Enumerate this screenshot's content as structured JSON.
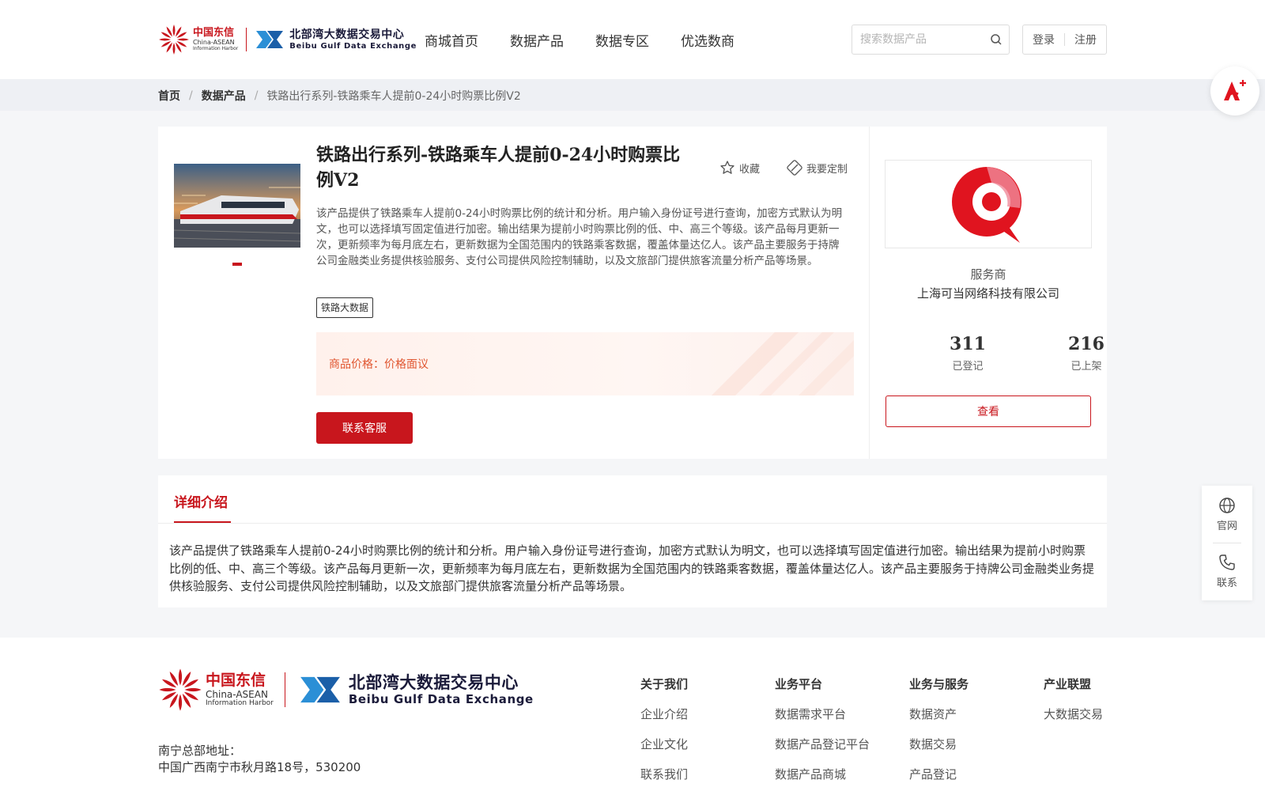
{
  "header": {
    "logo1": {
      "cn": "中国东信",
      "en": "China-ASEAN",
      "en2": "Information Harbor"
    },
    "logo2": {
      "cn": "北部湾大数据交易中心",
      "en": "Beibu Gulf Data Exchange"
    },
    "nav": [
      "商城首页",
      "数据产品",
      "数据专区",
      "优选数商"
    ],
    "search_placeholder": "搜索数据产品",
    "login": "登录",
    "register": "注册"
  },
  "breadcrumb": {
    "home": "首页",
    "section": "数据产品",
    "current": "铁路出行系列-铁路乘车人提前0-24小时购票比例V2"
  },
  "product": {
    "title": "铁路出行系列-铁路乘车人提前0-24小时购票比例V2",
    "favorite": "收藏",
    "customize": "我要定制",
    "description": "该产品提供了铁路乘车人提前0-24小时购票比例的统计和分析。用户输入身份证号进行查询，加密方式默认为明文，也可以选择填写固定值进行加密。输出结果为提前小时购票比例的低、中、高三个等级。该产品每月更新一次，更新频率为每月底左右，更新数据为全国范围内的铁路乘客数据，覆盖体量达亿人。该产品主要服务于持牌公司金融类业务提供核验服务、支付公司提供风险控制辅助，以及文旅部门提供旅客流量分析产品等场景。",
    "tag": "铁路大数据",
    "price_label": "商品价格：",
    "price_value": "价格面议",
    "contact_button": "联系客服"
  },
  "provider": {
    "label": "服务商",
    "name": "上海可当网络科技有限公司",
    "stats": [
      {
        "value": "311",
        "label": "已登记"
      },
      {
        "value": "216",
        "label": "已上架"
      }
    ],
    "view_button": "查看"
  },
  "detail": {
    "tab": "详细介绍",
    "text": "该产品提供了铁路乘车人提前0-24小时购票比例的统计和分析。用户输入身份证号进行查询，加密方式默认为明文，也可以选择填写固定值进行加密。输出结果为提前小时购票比例的低、中、高三个等级。该产品每月更新一次，更新频率为每月底左右，更新数据为全国范围内的铁路乘客数据，覆盖体量达亿人。该产品主要服务于持牌公司金融类业务提供核验服务、支付公司提供风险控制辅助，以及文旅部门提供旅客流量分析产品等场景。"
  },
  "side_tools": {
    "website": "官网",
    "contact": "联系"
  },
  "footer": {
    "address_label": "南宁总部地址：",
    "address": "中国广西南宁市秋月路18号，530200",
    "columns": [
      {
        "title": "关于我们",
        "links": [
          "企业介绍",
          "企业文化",
          "联系我们"
        ]
      },
      {
        "title": "业务平台",
        "links": [
          "数据需求平台",
          "数据产品登记平台",
          "数据产品商城"
        ]
      },
      {
        "title": "业务与服务",
        "links": [
          "数据资产",
          "数据交易",
          "产品登记"
        ]
      },
      {
        "title": "产业联盟",
        "links": [
          "大数据交易"
        ]
      }
    ]
  },
  "colors": {
    "brand_red": "#c8161d",
    "price_orange": "#e0552f"
  },
  "icons": [
    "sun-logo-icon",
    "bbg-logo-icon",
    "search-icon",
    "app-logo-icon",
    "star-icon",
    "customize-icon",
    "provider-logo-icon",
    "globe-icon",
    "phone-icon"
  ]
}
